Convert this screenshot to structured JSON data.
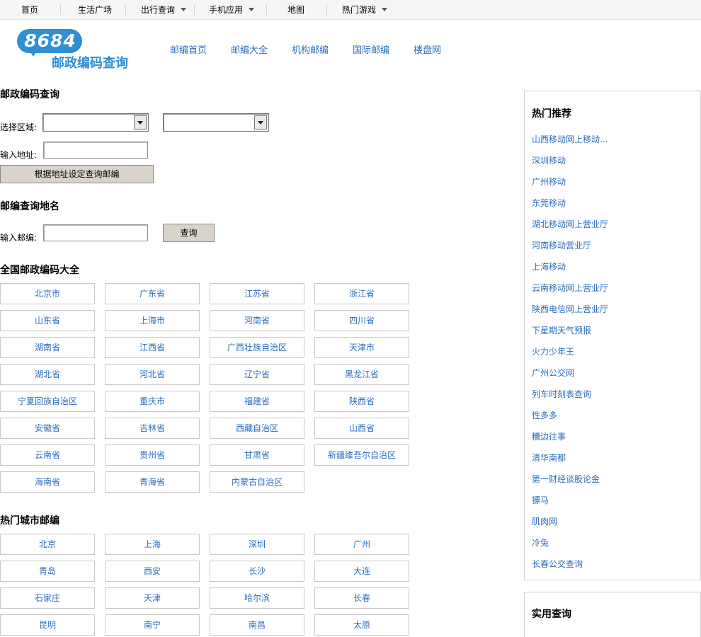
{
  "topnav": {
    "items": [
      "首页",
      "生活广场",
      "出行查询",
      "手机应用",
      "地图",
      "热门游戏"
    ]
  },
  "logo": {
    "number": "8684",
    "subtitle": "邮政编码查询"
  },
  "mainnav": {
    "items": [
      "邮编首页",
      "邮编大全",
      "机构邮编",
      "国际邮编",
      "楼盘网"
    ]
  },
  "query": {
    "title": "邮政编码查询",
    "region_label": "选择区域:",
    "address_label": "输入地址:",
    "address_value": "",
    "set_button": "根据地址设定查询邮编"
  },
  "lookup": {
    "title": "邮编查询地名",
    "zip_label": "输入邮编:",
    "zip_value": "",
    "search_button": "查询"
  },
  "provinces": {
    "title": "全国邮政编码大全",
    "items": [
      "北京市",
      "广东省",
      "江苏省",
      "浙江省",
      "山东省",
      "上海市",
      "河南省",
      "四川省",
      "湖南省",
      "江西省",
      "广西壮族自治区",
      "天津市",
      "湖北省",
      "河北省",
      "辽宁省",
      "黑龙江省",
      "宁夏回族自治区",
      "重庆市",
      "福建省",
      "陕西省",
      "安徽省",
      "吉林省",
      "西藏自治区",
      "山西省",
      "云南省",
      "贵州省",
      "甘肃省",
      "新疆维吾尔自治区",
      "海南省",
      "青海省",
      "内蒙古自治区"
    ]
  },
  "cities": {
    "title": "热门城市邮编",
    "items": [
      "北京",
      "上海",
      "深圳",
      "广州",
      "青岛",
      "西安",
      "长沙",
      "大连",
      "石家庄",
      "天津",
      "哈尔滨",
      "长春",
      "昆明",
      "南宁",
      "南昌",
      "太原"
    ]
  },
  "hot": {
    "title": "热门推荐",
    "items": [
      "山西移动网上移动...",
      "深圳移动",
      "广州移动",
      "东莞移动",
      "湖北移动网上营业厅",
      "河南移动营业厅",
      "上海移动",
      "云南移动网上营业厅",
      "陕西电信网上营业厅",
      "下星期天气预报",
      "火力少年王",
      "广州公交网",
      "列车时刻表查询",
      "性多多",
      "糟边往事",
      "清华南都",
      "第一财经谈股论金",
      "镖马",
      "肌肉网",
      "冷兔",
      "长春公交查询"
    ]
  },
  "useful": {
    "title": "实用查询"
  },
  "colors": {
    "link": "#2a6ebb",
    "brand": "#2e8ed6",
    "button": "#d8d4cc"
  }
}
